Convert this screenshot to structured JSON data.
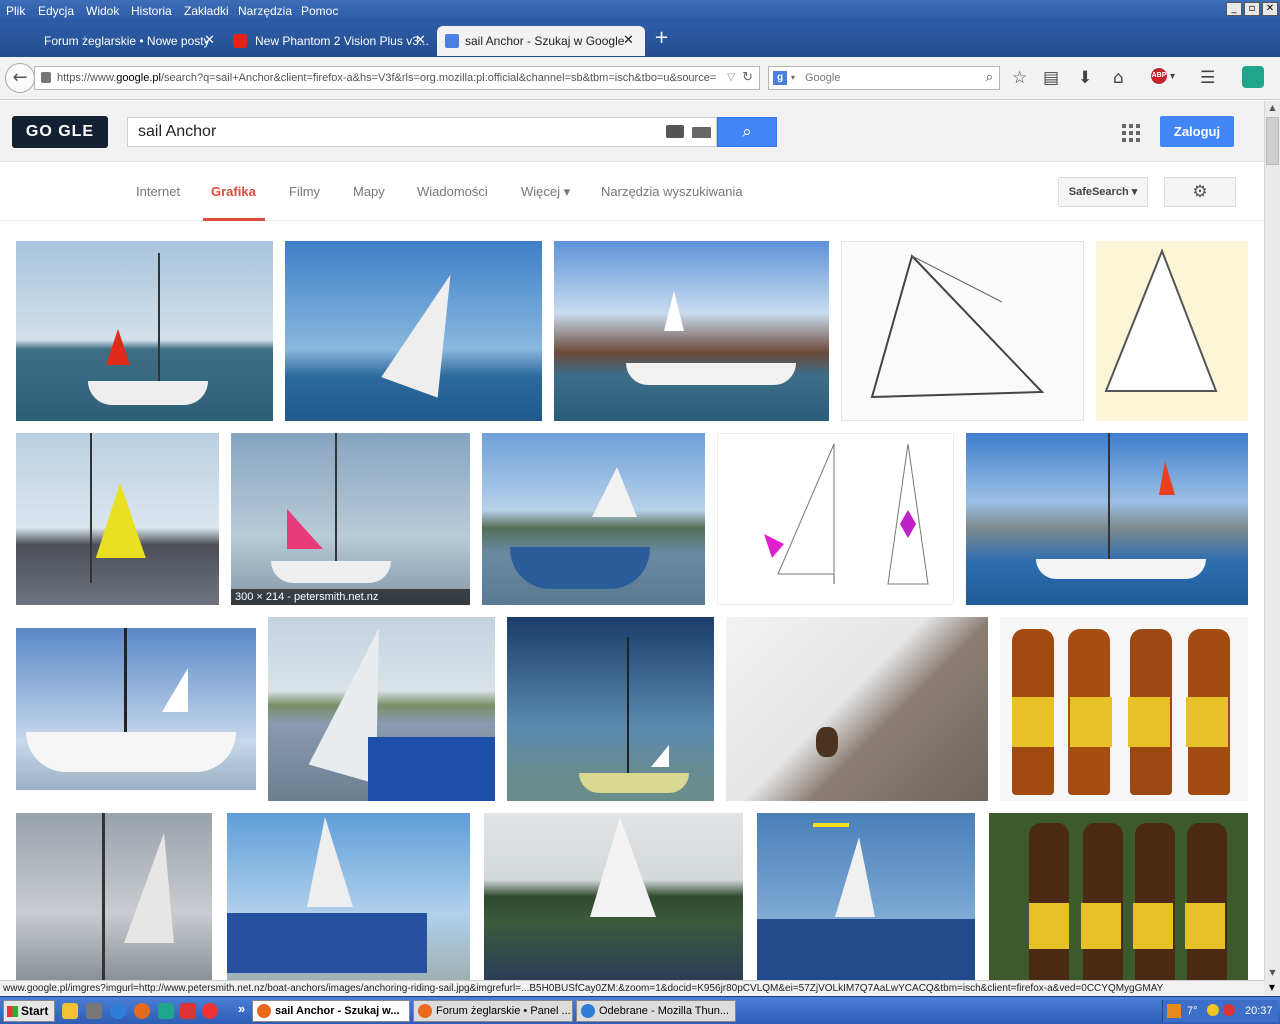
{
  "menubar": {
    "items": [
      "Plik",
      "Edycja",
      "Widok",
      "Historia",
      "Zakładki",
      "Narzędzia",
      "Pomoc"
    ]
  },
  "tabs": [
    {
      "label": "Forum żeglarskie • Nowe posty",
      "active": false
    },
    {
      "label": "New Phantom 2 Vision Plus v3...",
      "active": false
    },
    {
      "label": "sail Anchor - Szukaj w Google",
      "active": true
    }
  ],
  "new_tab_symbol": "+",
  "navbar": {
    "url_prefix": "https://www.",
    "url_domain": "google.pl",
    "url_rest": "/search?q=sail+Anchor&client=firefox-a&hs=V3f&rls=org.mozilla:pl:official&channel=sb&tbm=isch&tbo=u&source=",
    "search_engine_placeholder": "Google"
  },
  "google": {
    "logo_text": "GO GLE",
    "query": "sail Anchor",
    "login_label": "Zaloguj",
    "tabs": [
      {
        "label": "Internet",
        "active": false
      },
      {
        "label": "Grafika",
        "active": true
      },
      {
        "label": "Filmy",
        "active": false
      },
      {
        "label": "Mapy",
        "active": false
      },
      {
        "label": "Wiadomości",
        "active": false
      },
      {
        "label": "Więcej ▾",
        "active": false
      },
      {
        "label": "Narzędzia wyszukiwania",
        "active": false
      }
    ],
    "safesearch_label": "SafeSearch ▾"
  },
  "results": {
    "hover_caption": "300 × 214 - petersmith.net.nz"
  },
  "statusbar": {
    "text": "www.google.pl/imgres?imgurl=http://www.petersmith.net.nz/boat-anchors/images/anchoring-riding-sail.jpg&imgrefurl=...B5H0BUSfCay0ZM:&zoom=1&docid=K956jr80pCVLQM&ei=57ZjVOLkIM7Q7AaLwYCACQ&tbm=isch&client=firefox-a&ved=0CCYQMygGMAY"
  },
  "taskbar": {
    "start_label": "Start",
    "more_symbol": "»",
    "tasks": [
      {
        "label": "sail Anchor - Szukaj w...",
        "active": true
      },
      {
        "label": "Forum żeglarskie • Panel ...",
        "active": false
      },
      {
        "label": "Odebrane - Mozilla Thun...",
        "active": false
      }
    ],
    "temperature": "7°",
    "time": "20:37"
  }
}
